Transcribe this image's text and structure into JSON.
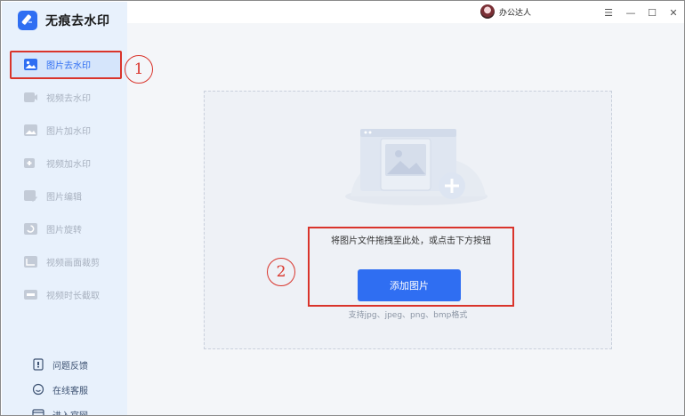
{
  "app": {
    "name": "无痕去水印",
    "user_name": "办公达人",
    "brand_color": "#2f6ef2",
    "annotation_color": "#d9342b"
  },
  "window_controls": [
    {
      "name": "menu-icon",
      "glyph": "☰"
    },
    {
      "name": "minimize-icon",
      "glyph": "—"
    },
    {
      "name": "maximize-icon",
      "glyph": "☐"
    },
    {
      "name": "close-icon",
      "glyph": "✕"
    }
  ],
  "sidebar": {
    "items": [
      {
        "label": "图片去水印",
        "icon": "image-icon",
        "active": true
      },
      {
        "label": "视频去水印",
        "icon": "video-icon",
        "active": false
      },
      {
        "label": "图片加水印",
        "icon": "image-add-icon",
        "active": false
      },
      {
        "label": "视频加水印",
        "icon": "video-add-icon",
        "active": false
      },
      {
        "label": "图片编辑",
        "icon": "image-edit-icon",
        "active": false
      },
      {
        "label": "图片旋转",
        "icon": "image-rotate-icon",
        "active": false
      },
      {
        "label": "视频画面裁剪",
        "icon": "video-crop-icon",
        "active": false
      },
      {
        "label": "视频时长截取",
        "icon": "video-trim-icon",
        "active": false
      }
    ],
    "bottom_links": [
      {
        "label": "问题反馈",
        "icon": "feedback-icon"
      },
      {
        "label": "在线客服",
        "icon": "support-icon"
      },
      {
        "label": "进入官网",
        "icon": "website-icon"
      }
    ]
  },
  "main": {
    "drop_hint": "将图片文件拖拽至此处，或点击下方按钮",
    "add_button": "添加图片",
    "supported_formats": "支持jpg、jpeg、png、bmp格式"
  },
  "annotations": {
    "marker_1": "1",
    "marker_2": "2"
  }
}
